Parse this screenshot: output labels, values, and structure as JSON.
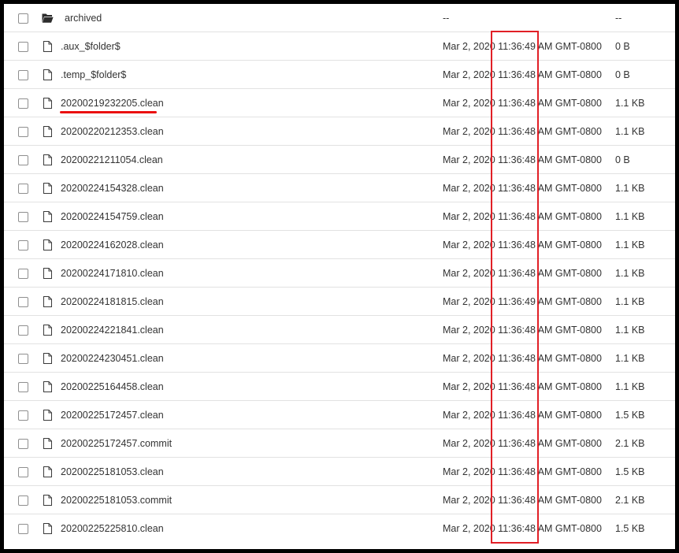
{
  "rows": [
    {
      "type": "folder",
      "name": "archived",
      "modified": "--",
      "size": "--"
    },
    {
      "type": "file",
      "name": ".aux_$folder$",
      "modified": "Mar 2, 2020 11:36:49 AM GMT-0800",
      "size": "0 B"
    },
    {
      "type": "file",
      "name": ".temp_$folder$",
      "modified": "Mar 2, 2020 11:36:48 AM GMT-0800",
      "size": "0 B"
    },
    {
      "type": "file",
      "name": "20200219232205.clean",
      "modified": "Mar 2, 2020 11:36:48 AM GMT-0800",
      "size": "1.1 KB"
    },
    {
      "type": "file",
      "name": "20200220212353.clean",
      "modified": "Mar 2, 2020 11:36:48 AM GMT-0800",
      "size": "1.1 KB"
    },
    {
      "type": "file",
      "name": "20200221211054.clean",
      "modified": "Mar 2, 2020 11:36:48 AM GMT-0800",
      "size": "0 B"
    },
    {
      "type": "file",
      "name": "20200224154328.clean",
      "modified": "Mar 2, 2020 11:36:48 AM GMT-0800",
      "size": "1.1 KB"
    },
    {
      "type": "file",
      "name": "20200224154759.clean",
      "modified": "Mar 2, 2020 11:36:48 AM GMT-0800",
      "size": "1.1 KB"
    },
    {
      "type": "file",
      "name": "20200224162028.clean",
      "modified": "Mar 2, 2020 11:36:48 AM GMT-0800",
      "size": "1.1 KB"
    },
    {
      "type": "file",
      "name": "20200224171810.clean",
      "modified": "Mar 2, 2020 11:36:48 AM GMT-0800",
      "size": "1.1 KB"
    },
    {
      "type": "file",
      "name": "20200224181815.clean",
      "modified": "Mar 2, 2020 11:36:49 AM GMT-0800",
      "size": "1.1 KB"
    },
    {
      "type": "file",
      "name": "20200224221841.clean",
      "modified": "Mar 2, 2020 11:36:48 AM GMT-0800",
      "size": "1.1 KB"
    },
    {
      "type": "file",
      "name": "20200224230451.clean",
      "modified": "Mar 2, 2020 11:36:48 AM GMT-0800",
      "size": "1.1 KB"
    },
    {
      "type": "file",
      "name": "20200225164458.clean",
      "modified": "Mar 2, 2020 11:36:48 AM GMT-0800",
      "size": "1.1 KB"
    },
    {
      "type": "file",
      "name": "20200225172457.clean",
      "modified": "Mar 2, 2020 11:36:48 AM GMT-0800",
      "size": "1.5 KB"
    },
    {
      "type": "file",
      "name": "20200225172457.commit",
      "modified": "Mar 2, 2020 11:36:48 AM GMT-0800",
      "size": "2.1 KB"
    },
    {
      "type": "file",
      "name": "20200225181053.clean",
      "modified": "Mar 2, 2020 11:36:48 AM GMT-0800",
      "size": "1.5 KB"
    },
    {
      "type": "file",
      "name": "20200225181053.commit",
      "modified": "Mar 2, 2020 11:36:48 AM GMT-0800",
      "size": "2.1 KB"
    },
    {
      "type": "file",
      "name": "20200225225810.clean",
      "modified": "Mar 2, 2020 11:36:48 AM GMT-0800",
      "size": "1.5 KB"
    }
  ],
  "icons": {
    "folder": "folder-open-icon",
    "file": "file-icon"
  },
  "colors": {
    "annotation": "#e11f26",
    "text": "#333333",
    "divider": "#e2e2e2"
  }
}
